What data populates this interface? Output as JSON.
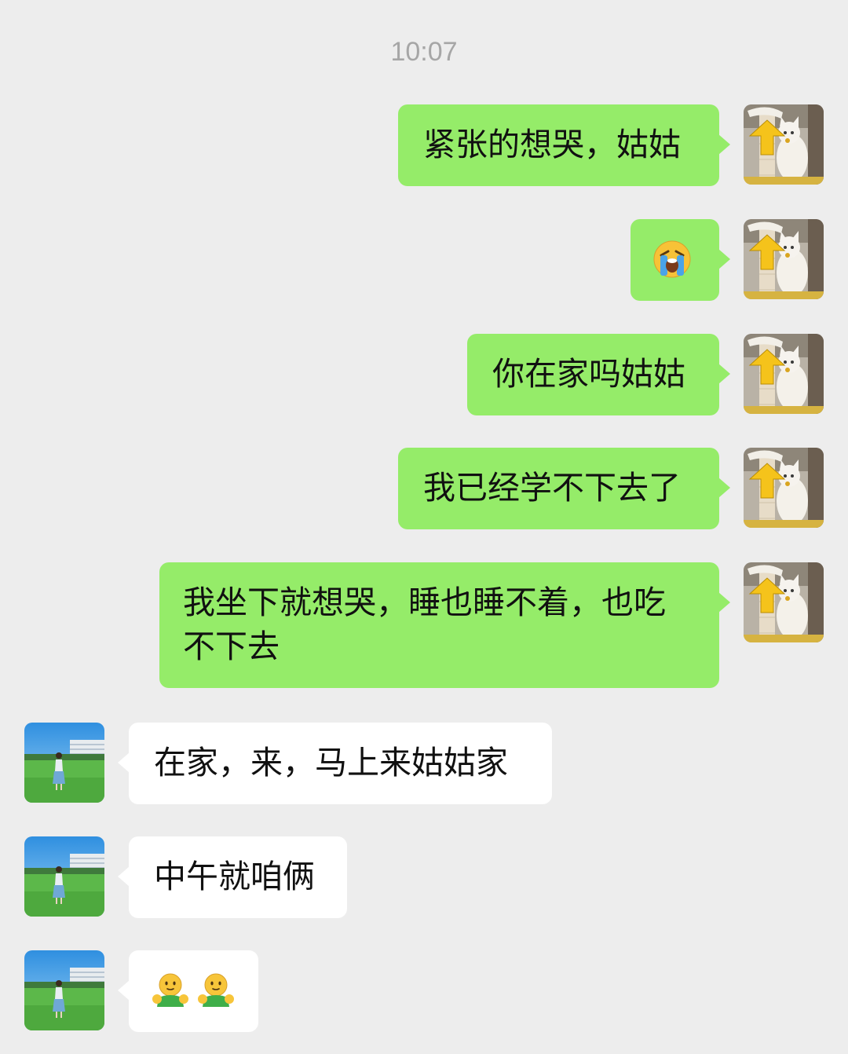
{
  "timestamp": "10:07",
  "messages": [
    {
      "direction": "out",
      "text": "紧张的想哭，姑姑"
    },
    {
      "direction": "out",
      "emoji": [
        "crying-face-emoji"
      ]
    },
    {
      "direction": "out",
      "text": "你在家吗姑姑"
    },
    {
      "direction": "out",
      "text": "我已经学不下去了"
    },
    {
      "direction": "out",
      "text": "我坐下就想哭，睡也睡不着，也吃不下去"
    },
    {
      "direction": "in",
      "text": "在家，来，马上来姑姑家"
    },
    {
      "direction": "in",
      "text": "中午就咱俩"
    },
    {
      "direction": "in",
      "emoji": [
        "hug-emoji",
        "hug-emoji"
      ]
    }
  ],
  "colors": {
    "background": "#ededed",
    "outgoing_bubble": "#95ec69",
    "incoming_bubble": "#ffffff",
    "timestamp_text": "#a6a6a6"
  },
  "avatars": {
    "self": "cat-avatar-icon",
    "contact": "person-on-field-avatar-icon"
  }
}
